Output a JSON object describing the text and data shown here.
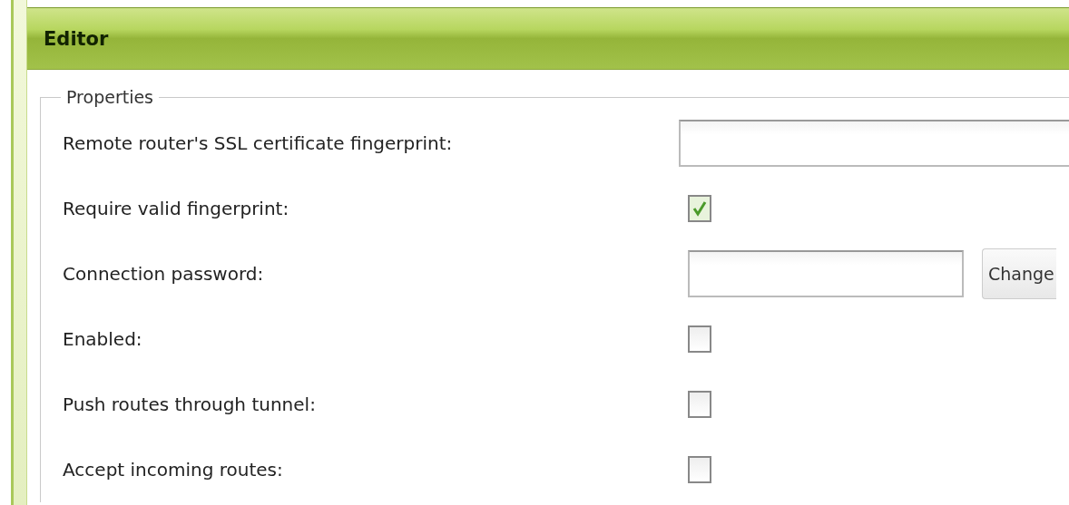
{
  "panel": {
    "title": "Editor"
  },
  "fieldset": {
    "legend": "Properties"
  },
  "rows": [
    {
      "kind": "text",
      "label": "Remote router's SSL certificate fingerprint:"
    },
    {
      "kind": "checkbox",
      "label": "Require valid fingerprint:",
      "checked": true
    },
    {
      "kind": "password",
      "label": "Connection password:",
      "button": "Change"
    },
    {
      "kind": "checkbox",
      "label": "Enabled:",
      "checked": false
    },
    {
      "kind": "checkbox",
      "label": "Push routes through tunnel:",
      "checked": false
    },
    {
      "kind": "checkbox",
      "label": "Accept incoming routes:",
      "checked": false
    }
  ]
}
